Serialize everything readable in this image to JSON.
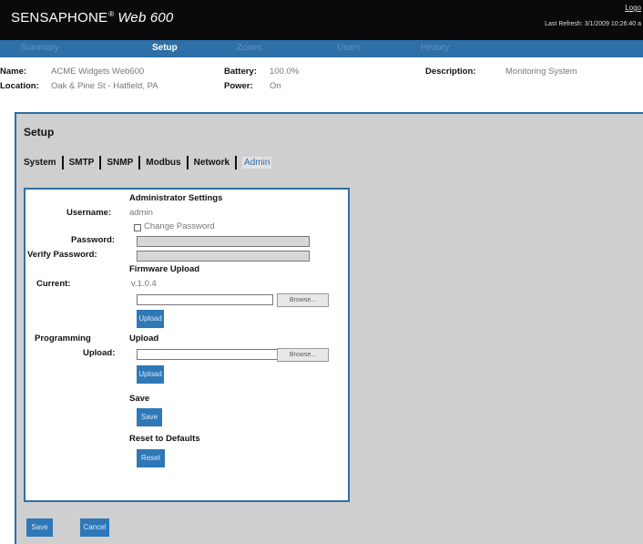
{
  "header": {
    "brand": "SENSAPHONE",
    "brand_mark": "®",
    "model": "Web 600",
    "logout": "Logo",
    "last_refresh": "Last Refresh: 3/1/2009 10:26:40 a"
  },
  "nav": {
    "tabs": [
      {
        "label": "Summary"
      },
      {
        "label": "Setup",
        "active": true
      },
      {
        "label": "Zones"
      },
      {
        "label": "Users"
      },
      {
        "label": "History"
      }
    ]
  },
  "info": {
    "name_label": "Name:",
    "name": "ACME Widgets Web600",
    "location_label": "Location:",
    "location": "Oak & Pine St - Hatfield, PA",
    "battery_label": "Battery:",
    "battery": "100.0%",
    "power_label": "Power:",
    "power": "On",
    "description_label": "Description:",
    "description": "Monitoring System"
  },
  "setup": {
    "title": "Setup",
    "subtabs": [
      {
        "label": "System"
      },
      {
        "label": "SMTP"
      },
      {
        "label": "SNMP"
      },
      {
        "label": "Modbus"
      },
      {
        "label": "Network"
      },
      {
        "label": "Admin",
        "active": true
      }
    ],
    "admin_heading": "Administrator Settings",
    "username_label": "Username:",
    "username": "admin",
    "change_password_label": "Change Password",
    "password_label": "Password:",
    "verify_password_label": "Verify Password:",
    "firmware_heading": "Firmware Upload",
    "current_label": "Current:",
    "current_version": "v.1.0.4",
    "browse_label": "Browse...",
    "upload_label": "Upload",
    "programming_label": "Programming",
    "upload_heading": "Upload",
    "upload_field_label": "Upload:",
    "save_heading": "Save",
    "save_label": "Save",
    "reset_heading": "Reset to Defaults",
    "reset_label": "Reset"
  },
  "footer": {
    "save_label": "Save",
    "cancel_label": "Cancel"
  },
  "colors": {
    "accent": "#2e6fa8",
    "header_bg": "#0a0a0a",
    "panel_bg": "#cfcfcf"
  }
}
